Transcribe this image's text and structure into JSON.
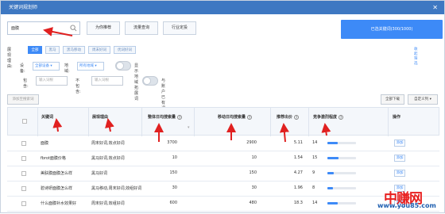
{
  "window": {
    "title": "关键词规划师",
    "close_icon": "close-icon"
  },
  "search": {
    "value": "面膜",
    "icon": "search-icon"
  },
  "tabs": [
    {
      "label": "为你推荐"
    },
    {
      "label": "流量查询"
    },
    {
      "label": "行业定投"
    }
  ],
  "selected_button": {
    "label": "已选关键词(300/1000)"
  },
  "filters": {
    "reason_label": "展现理由:",
    "chips": [
      "全部",
      "黑马",
      "黑马移动",
      "周末好词",
      "优词好词"
    ],
    "active_chip": "全部",
    "hide_link": "收起筛选",
    "device_label": "设备:",
    "device_value": "全部设备",
    "region_label": "地域:",
    "region_value": "所有地域",
    "toggle1_label": "显示地域拓展词",
    "include_label": "包含:",
    "include_placeholder": "输入词根",
    "exclude_label": "不包含:",
    "exclude_placeholder": "输入词根",
    "toggle2_label": "与账户已有词去重"
  },
  "toolbar": {
    "add_button": "添加至搜索词",
    "download_button": "全部下载",
    "custom_button": "自定义列"
  },
  "table": {
    "headers": [
      "关键词",
      "展现理由",
      "整体日均搜索量",
      "移动日均搜索量",
      "推荐出价",
      "竞争激烈程度",
      "操作"
    ],
    "rows": [
      {
        "keyword": "面膜",
        "reason": "周末好词,效点好词",
        "total": "3700",
        "mobile": "2900",
        "bid": "5.11",
        "comp": "14",
        "comp_pct": 0.35,
        "action": "添加"
      },
      {
        "keyword": "fbrot面膜价格",
        "reason": "黑马好词,效点好词",
        "total": "10",
        "mobile": "10",
        "bid": "1.54",
        "comp": "15",
        "comp_pct": 0.38,
        "action": "添加"
      },
      {
        "keyword": "美肤膜面膜怎么样",
        "reason": "黑马好词",
        "total": "150",
        "mobile": "150",
        "bid": "4.27",
        "comp": "9",
        "comp_pct": 0.22,
        "action": "添加"
      },
      {
        "keyword": "碧诗妍面膜怎么样",
        "reason": "黑马移动,周末好词,效组好词",
        "total": "30",
        "mobile": "30",
        "bid": "1.96",
        "comp": "8",
        "comp_pct": 0.2,
        "action": "添加"
      },
      {
        "keyword": "什么面膜补水效果好",
        "reason": "周末好词,效组好词",
        "total": "600",
        "mobile": "480",
        "bid": "18.3",
        "comp": "14",
        "comp_pct": 0.35,
        "action": "添加"
      }
    ]
  },
  "watermark": {
    "cn": "中赚网",
    "url": "www.you85.com"
  },
  "colors": {
    "accent": "#3d8af7",
    "title_bar": "#3e78c2",
    "annotation": "#e02020"
  }
}
